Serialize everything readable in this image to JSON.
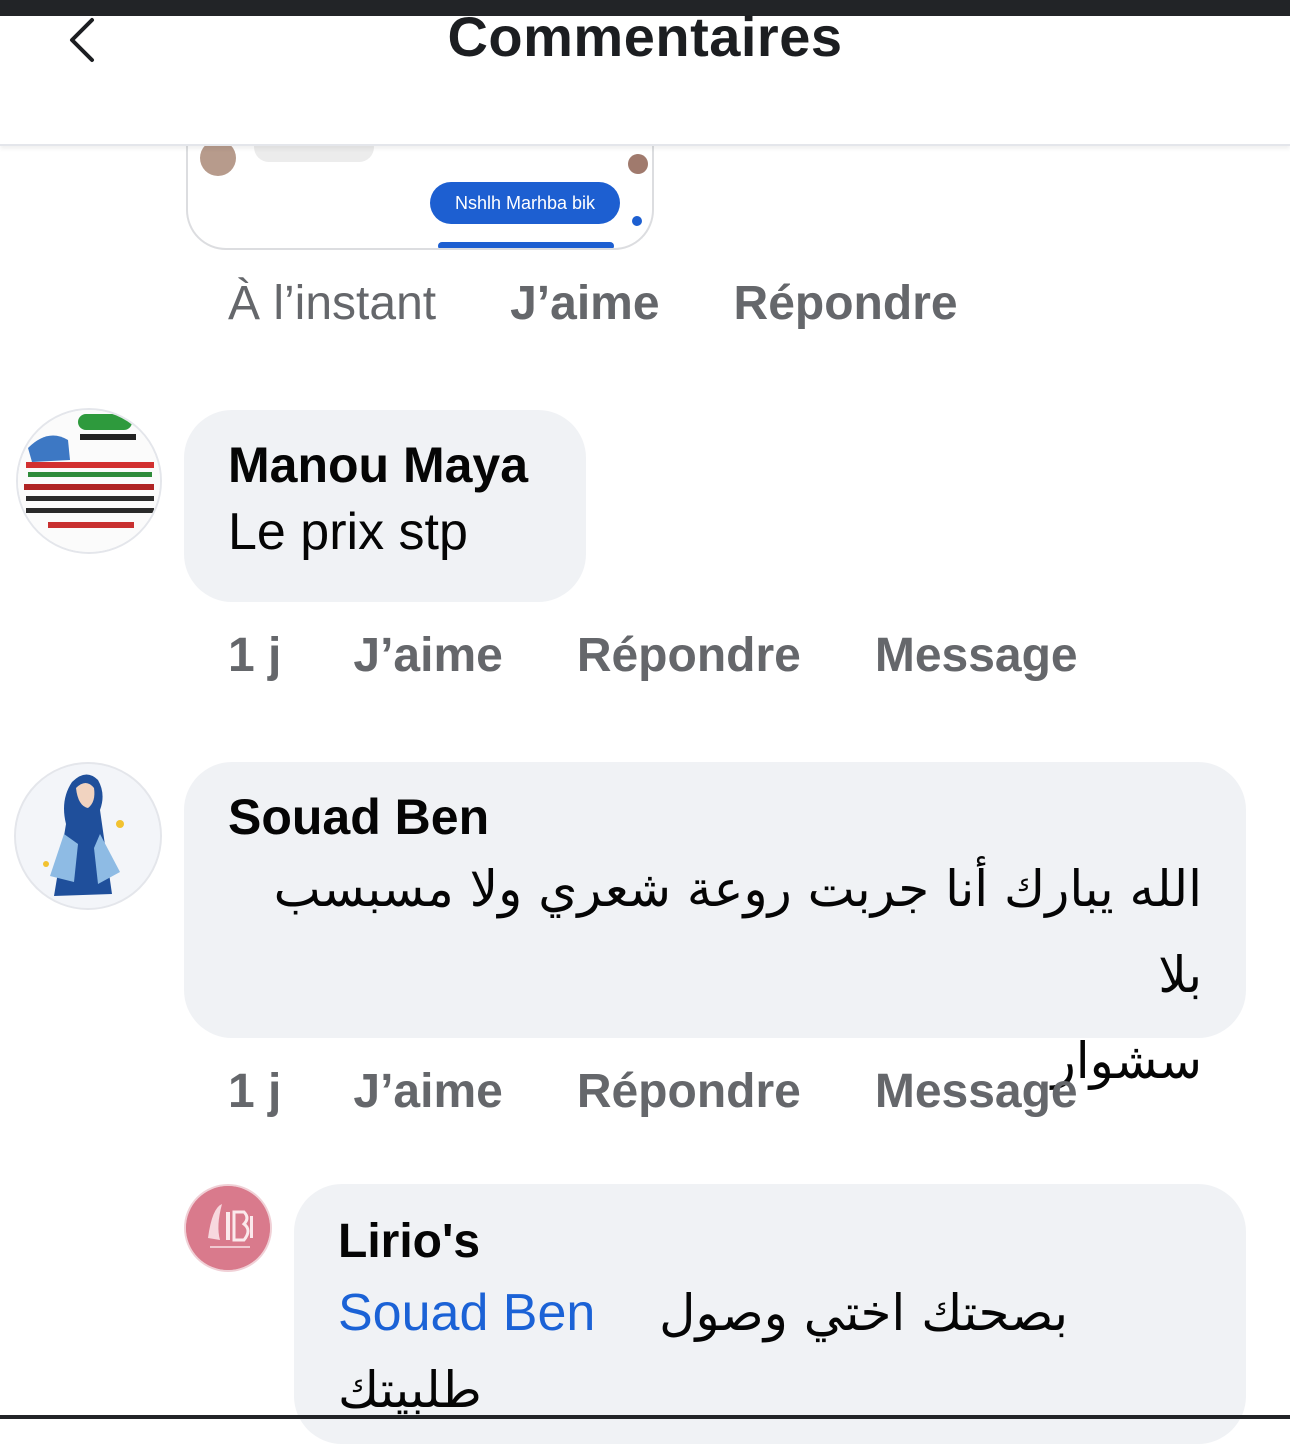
{
  "header": {
    "title": "Commentaires",
    "back_icon": "chevron-left-icon"
  },
  "top_card": {
    "blurred_name": "naemand",
    "reply_bubble": "Nshlh Marhba bik",
    "bubble_color": "#1d5fd1"
  },
  "top_actions": {
    "time": "À l’instant",
    "like": "J’aime",
    "reply": "Répondre"
  },
  "comments": [
    {
      "author": "Manou Maya",
      "text": "Le prix stp",
      "time": "1 j",
      "like": "J’aime",
      "reply": "Répondre",
      "message": "Message"
    },
    {
      "author": "Souad Ben",
      "text_line1": "الله يبارك أنا جربت روعة شعري ولا مسبسب بلا",
      "text_line2": "سشوار",
      "time": "1 j",
      "like": "J’aime",
      "reply": "Répondre",
      "message": "Message"
    }
  ],
  "reply": {
    "author": "Lirio's",
    "mention": "Souad Ben",
    "text_line1": "بصحتك اختي وصول",
    "text_line2": "طلبيتك"
  },
  "colors": {
    "bubble_bg": "#f0f2f5",
    "action_text": "#65676b",
    "mention": "#1b62d6",
    "reply_avatar_bg": "#d97a8c"
  }
}
